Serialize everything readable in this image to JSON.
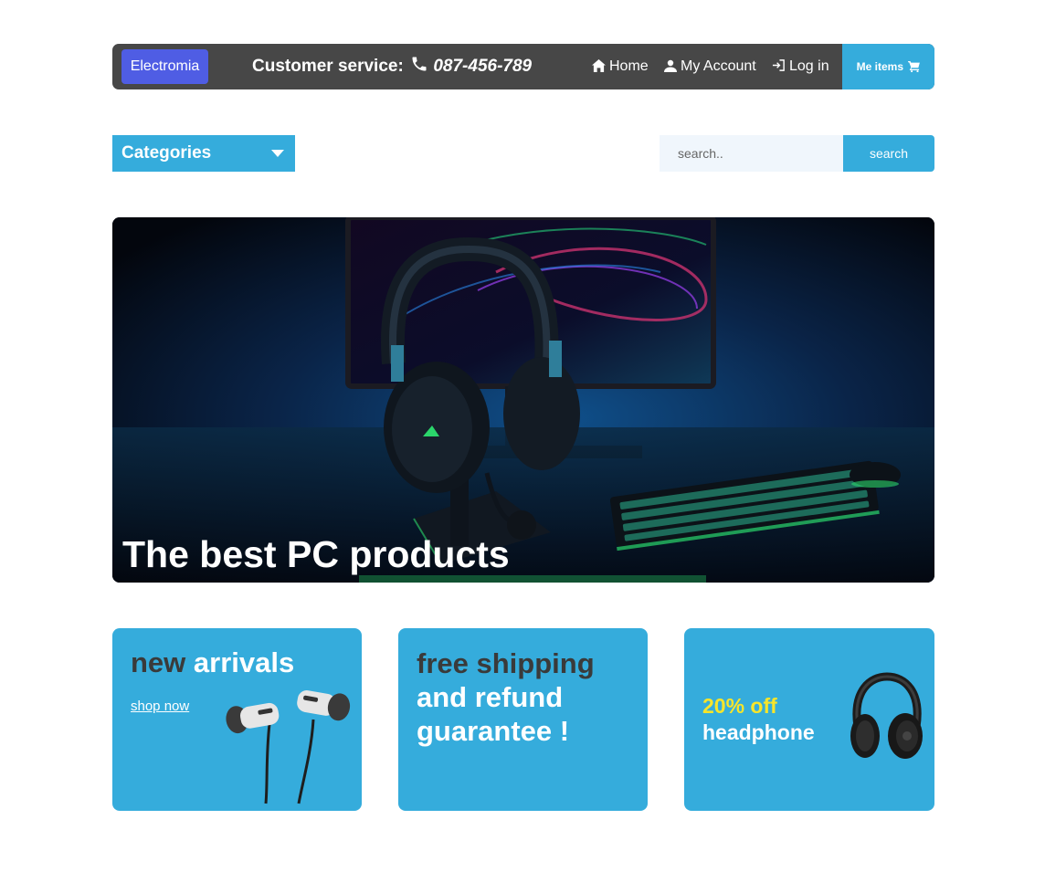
{
  "header": {
    "brand": "Electromia",
    "customer_service_label": "Customer service:",
    "phone": "087-456-789",
    "nav": {
      "home": "Home",
      "account": "My Account",
      "login": "Log in"
    },
    "cart_label": "Me items"
  },
  "toolbar": {
    "categories_label": "Categories",
    "search_placeholder": "search..",
    "search_button": "search"
  },
  "hero": {
    "title": "The best PC products"
  },
  "promos": {
    "card1": {
      "title_dark": "new",
      "title_light": "arrivals",
      "link": "shop now"
    },
    "card2": {
      "line1": "free shipping",
      "line2": "and refund",
      "line3": "guarantee !"
    },
    "card3": {
      "discount": "20% off",
      "product": "headphone"
    }
  },
  "colors": {
    "accent": "#35acdc",
    "brand": "#4f5de4",
    "header_bg": "#474747",
    "discount_yellow": "#f7e52a",
    "dark_text": "#3a3a3a"
  },
  "icons": [
    "phone-icon",
    "home-icon",
    "user-icon",
    "login-icon",
    "cart-icon",
    "chevron-down-icon"
  ]
}
